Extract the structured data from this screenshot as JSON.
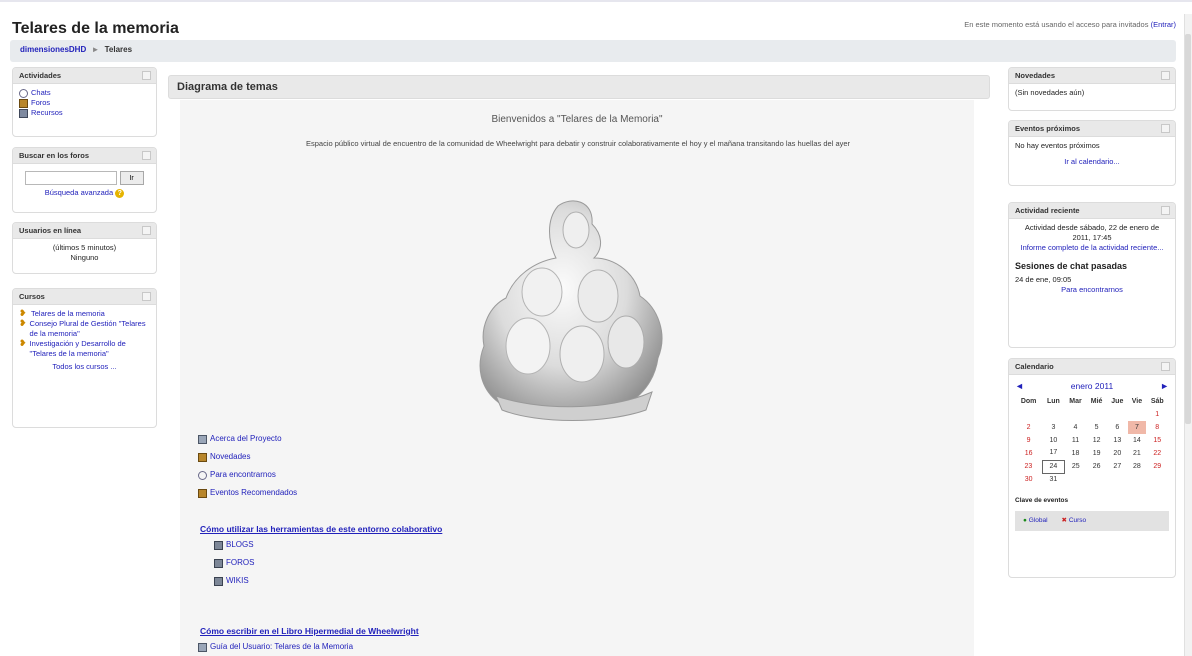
{
  "header": {
    "title": "Telares de la memoria",
    "login_text": "En este momento está usando el acceso para invitados",
    "login_link": "(Entrar)"
  },
  "navbar": {
    "home": "dimensionesDHD",
    "separator": "►",
    "current": "Telares"
  },
  "left": {
    "activities": {
      "title": "Actividades",
      "items": [
        {
          "label": "Chats",
          "icon": "chat-icon"
        },
        {
          "label": "Foros",
          "icon": "forum-icon"
        },
        {
          "label": "Recursos",
          "icon": "resource-icon"
        }
      ]
    },
    "search": {
      "title": "Buscar en los foros",
      "button": "Ir",
      "advanced": "Búsqueda avanzada"
    },
    "online": {
      "title": "Usuarios en línea",
      "subtitle": "(últimos 5 minutos)",
      "value": "Ninguno"
    },
    "courses": {
      "title": "Cursos",
      "items": [
        {
          "label": "Telares de la memoria"
        },
        {
          "label": "Consejo Plural de Gestión \"Telares de la memoria\""
        },
        {
          "label": "Investigación y Desarrollo de \"Telares de la memoria\""
        }
      ],
      "all": "Todos los cursos ..."
    }
  },
  "main": {
    "heading": "Diagrama de temas",
    "welcome": "Bienvenidos a \"Telares de la Memoria\"",
    "description": "Espacio público virtual de encuentro de la comunidad de Wheelwright para debatir y construir colaborativamente el hoy y el mañana transitando las huellas del ayer",
    "links": [
      {
        "label": "Acerca del Proyecto",
        "icon": "document-icon"
      },
      {
        "label": "Novedades",
        "icon": "forum-icon"
      },
      {
        "label": "Para encontrarnos",
        "icon": "chat-icon"
      },
      {
        "label": "Eventos Recomendados",
        "icon": "forum-icon"
      }
    ],
    "section1": {
      "title": "Cómo utilizar las herramientas de este entorno colaborativo",
      "items": [
        {
          "label": "BLOGS"
        },
        {
          "label": "FOROS"
        },
        {
          "label": "WIKIS"
        }
      ]
    },
    "section2": {
      "title": "Cómo escribir en el Libro Hipermedial de Wheelwright",
      "items": [
        {
          "label": "Guía del Usuario: Telares de la Memoria"
        }
      ]
    }
  },
  "right": {
    "news": {
      "title": "Novedades",
      "value": "(Sin novedades aún)"
    },
    "events": {
      "title": "Eventos próximos",
      "value": "No hay eventos próximos",
      "link": "Ir al calendario..."
    },
    "recent": {
      "title": "Actividad reciente",
      "since": "Actividad desde sábado, 22 de enero de 2011, 17:45",
      "report_link": "Informe completo de la actividad reciente...",
      "chat_title": "Sesiones de chat pasadas",
      "chat_date": "24 de ene, 09:05",
      "chat_link": "Para encontrarnos"
    },
    "calendar": {
      "title": "Calendario",
      "month": "enero 2011",
      "prev": "◄",
      "next": "►",
      "days": [
        "Dom",
        "Lun",
        "Mar",
        "Mié",
        "Jue",
        "Vie",
        "Sáb"
      ],
      "weeks": [
        [
          "",
          "",
          "",
          "",
          "",
          "",
          "1"
        ],
        [
          "2",
          "3",
          "4",
          "5",
          "6",
          "7",
          "8"
        ],
        [
          "9",
          "10",
          "11",
          "12",
          "13",
          "14",
          "15"
        ],
        [
          "16",
          "17",
          "18",
          "19",
          "20",
          "21",
          "22"
        ],
        [
          "23",
          "24",
          "25",
          "26",
          "27",
          "28",
          "29"
        ],
        [
          "30",
          "31",
          "",
          "",
          "",
          "",
          ""
        ]
      ],
      "event_day": "7",
      "today": "24",
      "key_title": "Clave de eventos",
      "key_global": "Global",
      "key_course": "Curso"
    }
  }
}
